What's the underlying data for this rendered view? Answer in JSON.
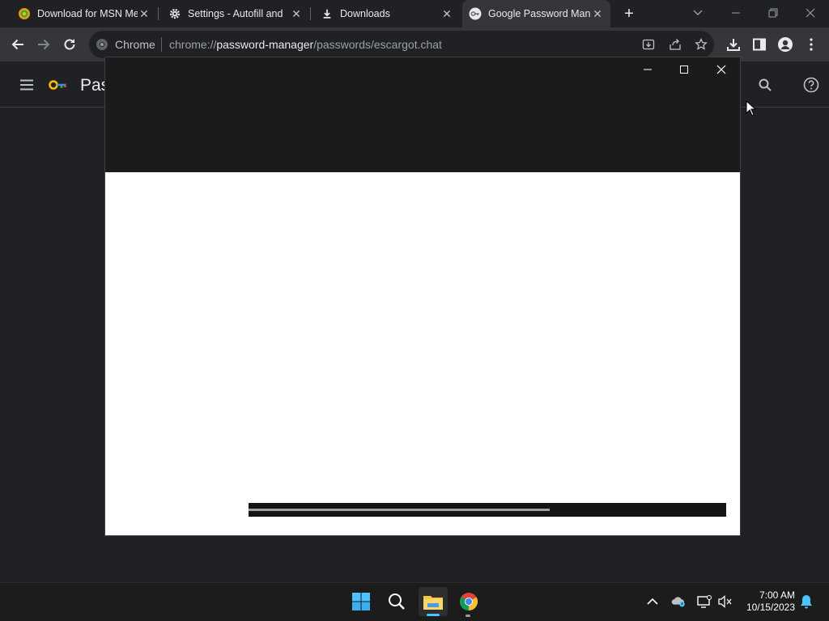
{
  "browser": {
    "tabs": [
      {
        "title": "Download for MSN Me",
        "favicon": "escargot-icon",
        "active": false
      },
      {
        "title": "Settings - Autofill and",
        "favicon": "gear-icon",
        "active": false
      },
      {
        "title": "Downloads",
        "favicon": "download-icon",
        "active": false
      },
      {
        "title": "Google Password Man",
        "favicon": "password-key-icon",
        "active": true
      }
    ],
    "omnibox": {
      "chip": "Chrome",
      "url_scheme": "chrome://",
      "url_host": "password-manager",
      "url_path": "/passwords/escargot.chat"
    }
  },
  "page": {
    "title": "Pas"
  },
  "overlay_window": {
    "progress": 0.63
  },
  "taskbar": {
    "time": "7:00 AM",
    "date": "10/15/2023"
  },
  "colors": {
    "page_bg": "#202124",
    "toolbar_bg": "#35363a",
    "overlay_header": "#1b1b1b",
    "accent": "#4cc2ff"
  }
}
